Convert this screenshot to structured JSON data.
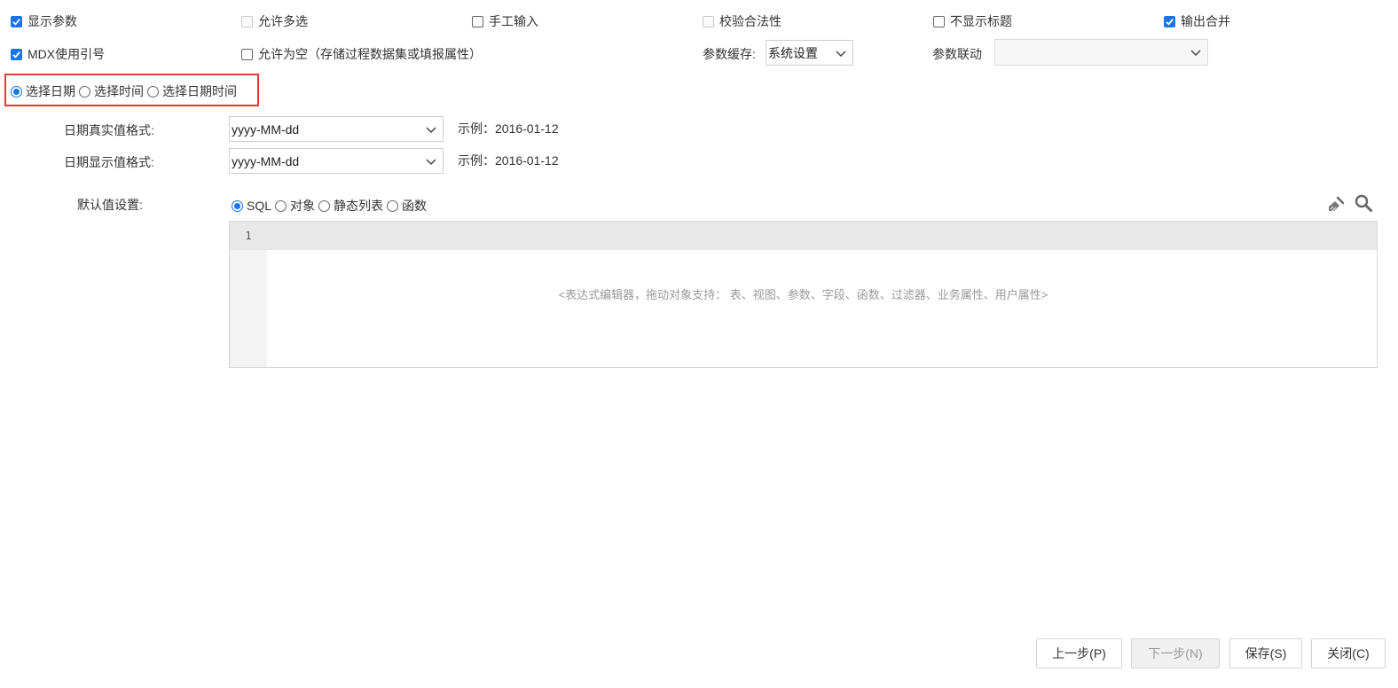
{
  "options_row1": {
    "show_param": {
      "label": "显示参数",
      "checked": true,
      "disabled": false
    },
    "allow_multi": {
      "label": "允许多选",
      "checked": false,
      "disabled": true
    },
    "manual_input": {
      "label": "手工输入",
      "checked": false,
      "disabled": false
    },
    "validate": {
      "label": "校验合法性",
      "checked": false,
      "disabled": true
    },
    "hide_title": {
      "label": "不显示标题",
      "checked": false,
      "disabled": false
    },
    "output_merge": {
      "label": "输出合并",
      "checked": true,
      "disabled": false
    }
  },
  "options_row2": {
    "mdx_quote": {
      "label": "MDX使用引号",
      "checked": true
    },
    "allow_empty": {
      "label": "允许为空（存储过程数据集或填报属性）",
      "checked": false
    },
    "param_cache_label": "参数缓存:",
    "param_cache_value": "系统设置",
    "param_link_label": "参数联动",
    "param_link_value": ""
  },
  "date_mode": {
    "options": [
      "选择日期",
      "选择时间",
      "选择日期时间"
    ],
    "selected": 0
  },
  "formats": {
    "real_label": "日期真实值格式:",
    "real_value": "yyyy-MM-dd",
    "real_example": "示例：2016-01-12",
    "display_label": "日期显示值格式:",
    "display_value": "yyyy-MM-dd",
    "display_example": "示例：2016-01-12"
  },
  "default_value": {
    "label": "默认值设置:",
    "modes": [
      "SQL",
      "对象",
      "静态列表",
      "函数"
    ],
    "selected": 0
  },
  "editor": {
    "line_number": "1",
    "placeholder": "<表达式编辑器，拖动对象支持： 表、视图、参数、字段、函数、过滤器、业务属性、用户属性>"
  },
  "icons": {
    "clear": "broom-icon",
    "search": "search-icon"
  },
  "accent_color": "#1a73e8",
  "highlight_color": "#e53935",
  "footer": {
    "prev": "上一步(P)",
    "next": "下一步(N)",
    "save": "保存(S)",
    "close": "关闭(C)"
  }
}
